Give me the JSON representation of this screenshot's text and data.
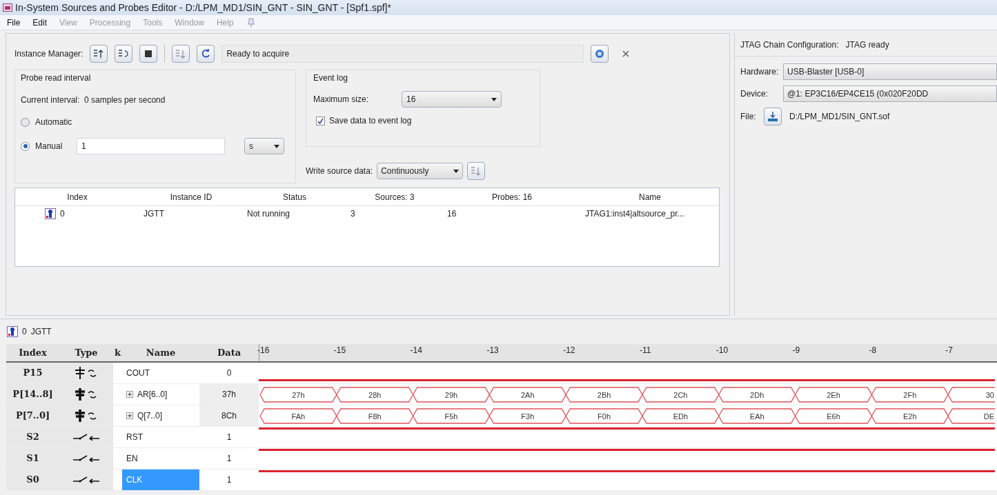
{
  "window": {
    "title": "In-System Sources and Probes Editor - D:/LPM_MD1/SIN_GNT - SIN_GNT - [Spf1.spf]*"
  },
  "menu": [
    {
      "label": "File",
      "disabled": false
    },
    {
      "label": "Edit",
      "disabled": false
    },
    {
      "label": "View",
      "disabled": true
    },
    {
      "label": "Processing",
      "disabled": true
    },
    {
      "label": "Tools",
      "disabled": true
    },
    {
      "label": "Window",
      "disabled": true
    },
    {
      "label": "Help",
      "disabled": true
    }
  ],
  "instance_manager": {
    "label": "Instance Manager:",
    "status": "Ready to acquire"
  },
  "probe_read_interval": {
    "title": "Probe read interval",
    "current_interval": "Current interval:  0 samples per second",
    "options": [
      {
        "label": "Automatic",
        "selected": false
      },
      {
        "label": "Manual",
        "selected": true
      }
    ],
    "interval_value": "1",
    "unit": "s"
  },
  "event_log": {
    "title": "Event log",
    "max_size_label": "Maximum size:",
    "max_size": "16",
    "save": {
      "label": "Save data to event log",
      "checked": true
    }
  },
  "write_source_data": {
    "label": "Write source data:",
    "mode": "Continuously"
  },
  "instances": {
    "columns": [
      "Index",
      "Instance ID",
      "Status",
      "Sources: 3",
      "Probes: 16",
      "Name"
    ],
    "rows": [
      {
        "index": "0",
        "id": "JGTT",
        "status": "Not running",
        "sources": "3",
        "probes": "16",
        "name": "JTAG1:inst4|altsource_pr..."
      }
    ]
  },
  "jtag": {
    "title": "JTAG Chain Configuration:",
    "status": "JTAG ready",
    "hardware_label": "Hardware:",
    "hardware": "USB-Blaster [USB-0]",
    "device_label": "Device:",
    "device": "@1: EP3C16/EP4CE15 (0x020F20DD",
    "file_label": "File:",
    "file": "D:/LPM_MD1/SIN_GNT.sof"
  },
  "signals": {
    "instance": {
      "index": "0",
      "id": "JGTT"
    },
    "columns": [
      "Index",
      "Type",
      "k",
      "Name",
      "Data"
    ],
    "ticks": [
      "-16",
      "-15",
      "-14",
      "-13",
      "-12",
      "-11",
      "-10",
      "-9",
      "-8",
      "-7"
    ],
    "rows": [
      {
        "index": "P15",
        "name": "COUT",
        "data": "0",
        "kind": "probe",
        "high": false,
        "selected": false
      },
      {
        "index": "P[14..8]",
        "name": "AR[6..0]",
        "data": "37h",
        "kind": "bus",
        "values": [
          "27h",
          "28h",
          "29h",
          "2Ah",
          "2Bh",
          "2Ch",
          "2Dh",
          "2Eh",
          "2Fh",
          "30"
        ],
        "selected": false
      },
      {
        "index": "P[7..0]",
        "name": "Q[7..0]",
        "data": "8Ch",
        "kind": "bus",
        "values": [
          "FAh",
          "F8h",
          "F5h",
          "F3h",
          "F0h",
          "EDh",
          "EAh",
          "E6h",
          "E2h",
          "DE"
        ],
        "selected": false
      },
      {
        "index": "S2",
        "name": "RST",
        "data": "1",
        "kind": "source",
        "high": true,
        "selected": false
      },
      {
        "index": "S1",
        "name": "EN",
        "data": "1",
        "kind": "source",
        "high": true,
        "selected": false
      },
      {
        "index": "S0",
        "name": "CLK",
        "data": "1",
        "kind": "source",
        "high": true,
        "selected": true
      }
    ]
  }
}
